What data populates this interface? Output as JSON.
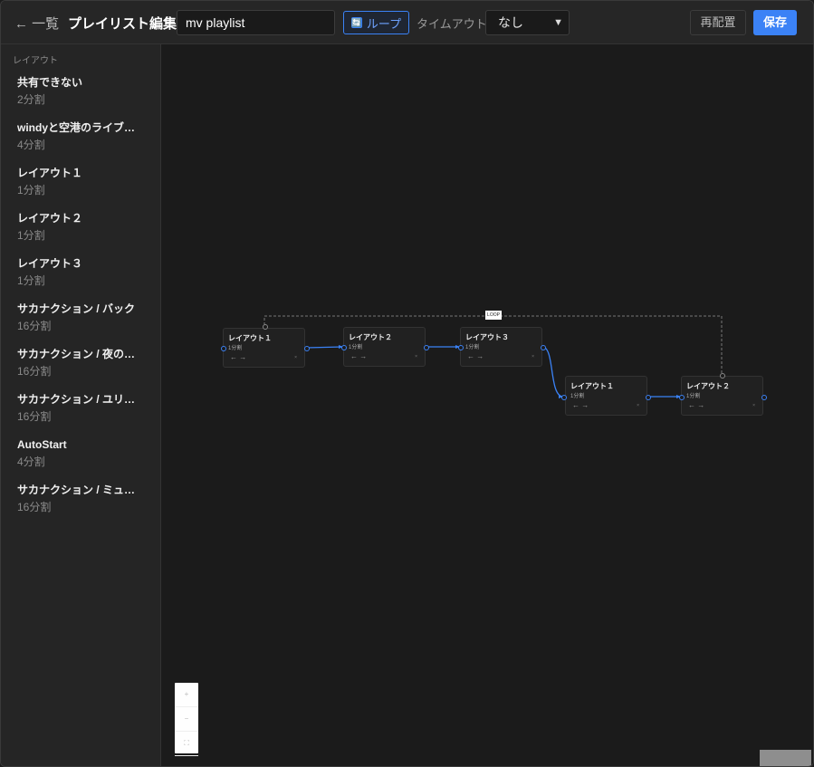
{
  "header": {
    "back_label": "← 一覧",
    "title": "プレイリスト編集",
    "name_value": "mv playlist",
    "loop_label": "ループ",
    "loop_icon": "🔄",
    "timeout_label": "タイムアウト",
    "timeout_value": "なし",
    "rearrange_label": "再配置",
    "save_label": "保存"
  },
  "sidebar": {
    "heading": "レイアウト",
    "items": [
      {
        "name": "共有できない",
        "sub": "2分割"
      },
      {
        "name": "windyと空港のライブ映像",
        "sub": "4分割"
      },
      {
        "name": "レイアウト１",
        "sub": "1分割"
      },
      {
        "name": "レイアウト２",
        "sub": "1分割"
      },
      {
        "name": "レイアウト３",
        "sub": "1分割"
      },
      {
        "name": "サカナクション / バック",
        "sub": "16分割"
      },
      {
        "name": "サカナクション / 夜の踊り子",
        "sub": "16分割"
      },
      {
        "name": "サカナクション / ユリイカ",
        "sub": "16分割"
      },
      {
        "name": "AutoStart",
        "sub": "4分割"
      },
      {
        "name": "サカナクション / ミュージック",
        "sub": "16分割"
      }
    ]
  },
  "flow": {
    "loop_tag": "LOOP",
    "nodes": [
      {
        "title": "レイアウト１",
        "sub": "1分割",
        "arrows": "←  →",
        "x_mark": "×"
      },
      {
        "title": "レイアウト２",
        "sub": "1分割",
        "arrows": "←  →",
        "x_mark": "×"
      },
      {
        "title": "レイアウト３",
        "sub": "1分割",
        "arrows": "←  →",
        "x_mark": "×"
      },
      {
        "title": "レイアウト１",
        "sub": "1分割",
        "arrows": "←  →",
        "x_mark": "×"
      },
      {
        "title": "レイアウト２",
        "sub": "1分割",
        "arrows": "←  →",
        "x_mark": "×"
      }
    ]
  },
  "controls": {
    "zoom_in": "+",
    "zoom_out": "−",
    "fit": "⛶"
  },
  "colors": {
    "accent": "#3b82f6",
    "background": "#1b1b1b",
    "sidebar": "#252525"
  }
}
